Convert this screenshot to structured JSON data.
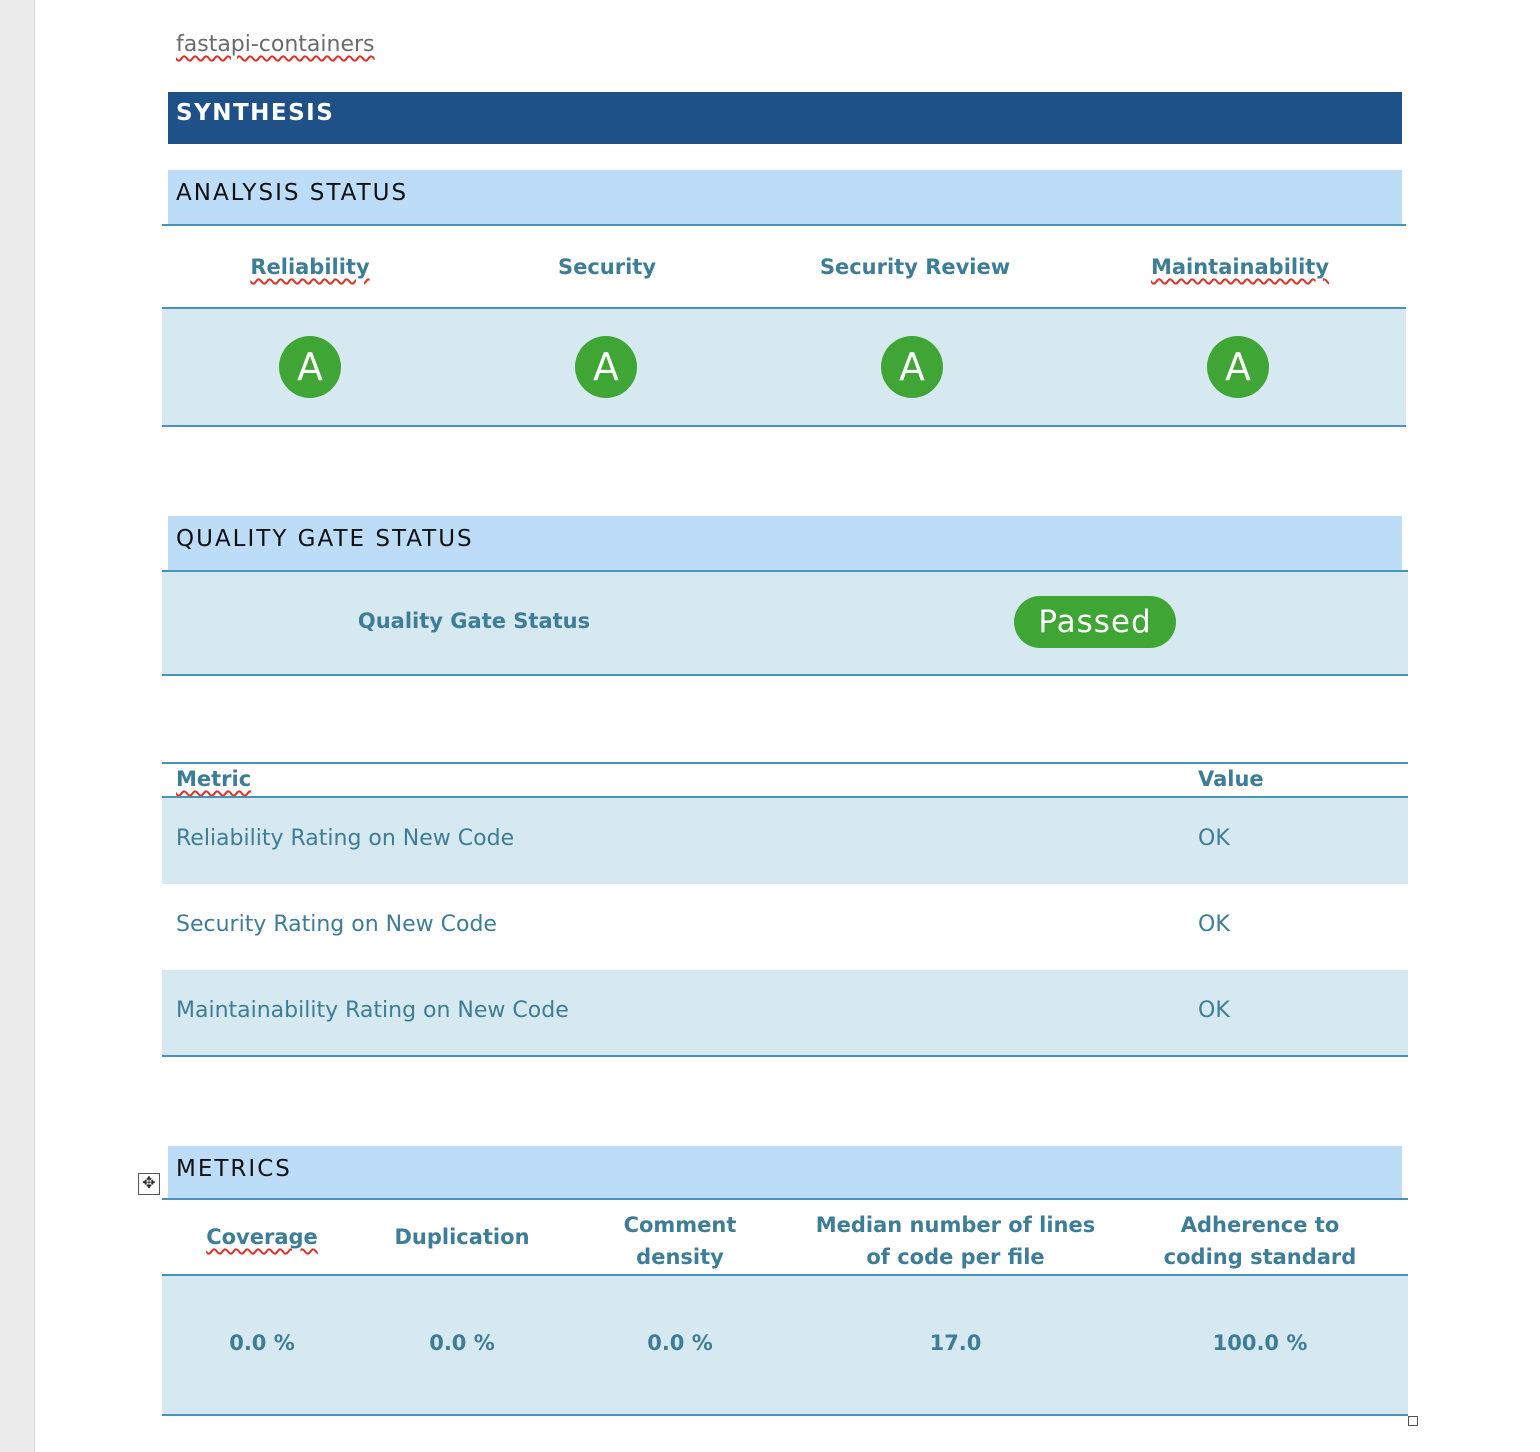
{
  "document": {
    "title": "fastapi-containers"
  },
  "synthesis": {
    "heading": "SYNTHESIS"
  },
  "analysis_status": {
    "heading": "ANALYSIS STATUS",
    "columns": [
      {
        "label": "Reliability",
        "grade": "A"
      },
      {
        "label": "Security",
        "grade": "A"
      },
      {
        "label": "Security Review",
        "grade": "A"
      },
      {
        "label": "Maintainability",
        "grade": "A"
      }
    ]
  },
  "quality_gate": {
    "heading": "QUALITY GATE STATUS",
    "label": "Quality Gate Status",
    "status": "Passed"
  },
  "conditions_table": {
    "headers": {
      "metric": "Metric",
      "value": "Value"
    },
    "rows": [
      {
        "metric": "Reliability Rating on New Code",
        "value": "OK"
      },
      {
        "metric": "Security Rating on New Code",
        "value": "OK"
      },
      {
        "metric": "Maintainability Rating on New Code",
        "value": "OK"
      }
    ]
  },
  "metrics": {
    "heading": "METRICS",
    "columns": [
      {
        "label": "Coverage",
        "value": "0.0 %"
      },
      {
        "label": "Duplication",
        "value": "0.0 %"
      },
      {
        "label": "Comment density",
        "value": "0.0 %"
      },
      {
        "label": "Median number of lines of code per file",
        "value": "17.0"
      },
      {
        "label": "Adherence to coding standard",
        "value": "100.0 %"
      }
    ]
  },
  "colors": {
    "brand_dark": "#1f5189",
    "section_light": "#bcdcf8",
    "table_band": "#d6e8f0",
    "text_blue": "#3d7d96",
    "pass_green": "#3fa535"
  }
}
